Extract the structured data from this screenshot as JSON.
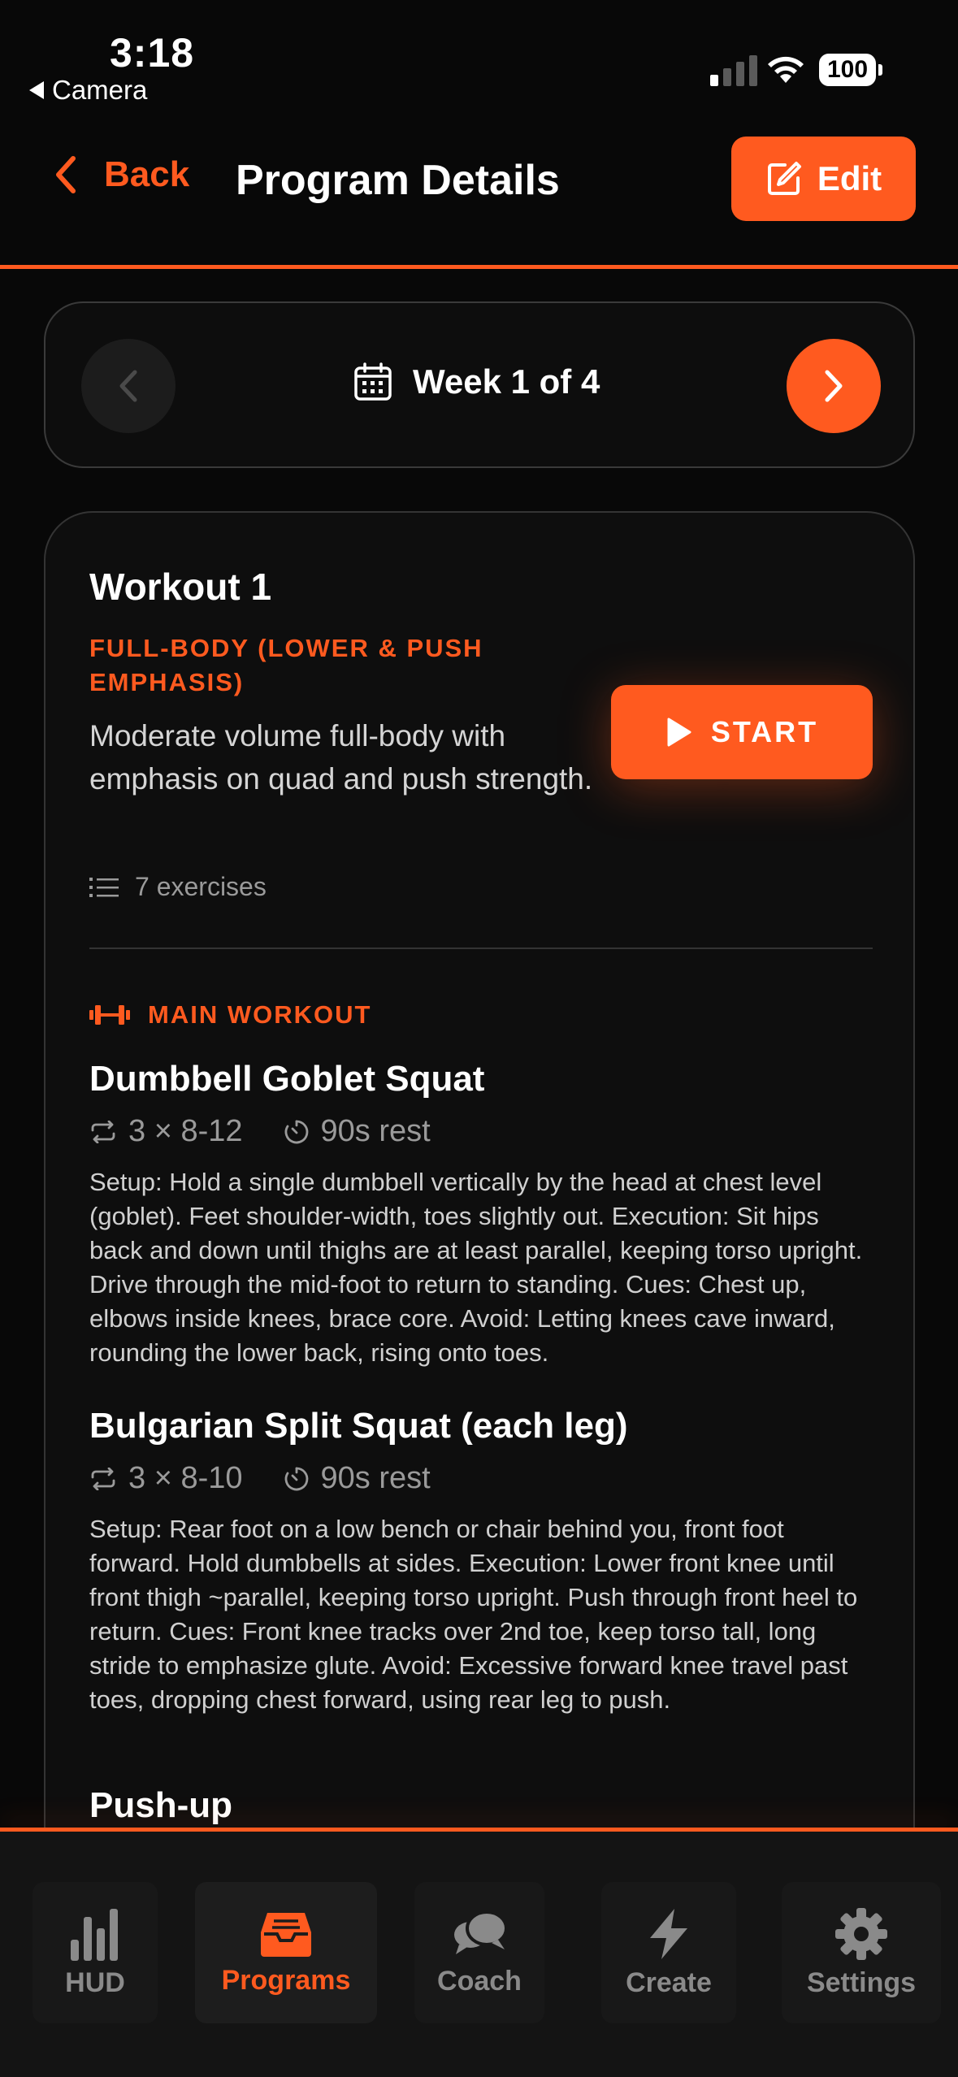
{
  "status_bar": {
    "time": "3:18",
    "back_app": "Camera",
    "battery": "100"
  },
  "header": {
    "back_label": "Back",
    "title": "Program Details",
    "edit_label": "Edit"
  },
  "week": {
    "label": "Week 1 of 4"
  },
  "workout": {
    "title": "Workout 1",
    "type": "FULL-BODY (LOWER & PUSH EMPHASIS)",
    "description": "Moderate volume full-body with emphasis on quad and push strength.",
    "exercise_count": "7 exercises",
    "start_label": "START",
    "section_label": "MAIN WORKOUT",
    "exercises": [
      {
        "name": "Dumbbell Goblet Squat",
        "sets": "3 × 8-12",
        "rest": "90s rest",
        "instructions": "Setup: Hold a single dumbbell vertically by the head at chest level (goblet). Feet shoulder-width, toes slightly out. Execution: Sit hips back and down until thighs are at least parallel, keeping torso upright. Drive through the mid-foot to return to standing. Cues: Chest up, elbows inside knees, brace core. Avoid: Letting knees cave inward, rounding the lower back, rising onto toes."
      },
      {
        "name": "Bulgarian Split Squat (each leg)",
        "sets": "3 × 8-10",
        "rest": "90s rest",
        "instructions": "Setup: Rear foot on a low bench or chair behind you, front foot forward. Hold dumbbells at sides. Execution: Lower front knee until front thigh ~parallel, keeping torso upright. Push through front heel to return. Cues: Front knee tracks over 2nd toe, keep torso tall, long stride to emphasize glute. Avoid: Excessive forward knee travel past toes, dropping chest forward, using rear leg to push."
      },
      {
        "name": "Push-up"
      }
    ]
  },
  "nav": {
    "items": [
      {
        "label": "HUD",
        "icon": "bar-chart-icon"
      },
      {
        "label": "Programs",
        "icon": "inbox-tray-icon"
      },
      {
        "label": "Coach",
        "icon": "chat-bubbles-icon"
      },
      {
        "label": "Create",
        "icon": "lightning-icon"
      },
      {
        "label": "Settings",
        "icon": "gear-icon"
      }
    ],
    "active": "Programs"
  },
  "colors": {
    "accent": "#ff5a1f",
    "background": "#080808",
    "card": "#0e0e0e"
  }
}
